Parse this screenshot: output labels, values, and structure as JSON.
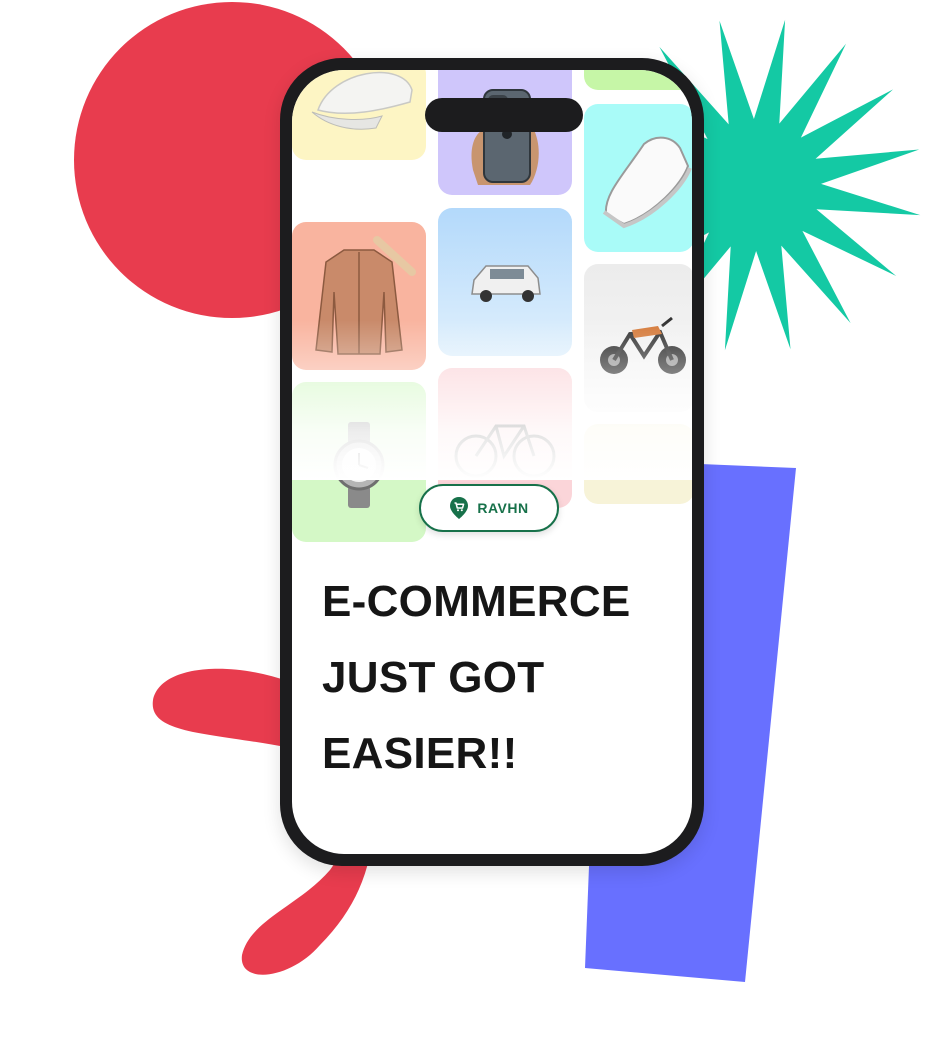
{
  "brand": {
    "name": "RAVHN",
    "icon": "shopping-cart-location-pin-icon",
    "color": "#17714a"
  },
  "headline": {
    "lines": [
      "E-COMMERCE",
      "JUST GOT",
      "EASIER!!"
    ]
  },
  "product_tiles": [
    {
      "icon": "cap-icon",
      "color": "#fdf5c4"
    },
    {
      "icon": "smartphone-icon",
      "color": "#cfc6fb"
    },
    {
      "icon": "sneaker-icon",
      "color": "#a9fbf8"
    },
    {
      "icon": "jacket-icon",
      "color": "#f9b49f"
    },
    {
      "icon": "suv-icon",
      "color": "#bfe0fb"
    },
    {
      "icon": "motorcycle-icon",
      "color": "#ececec"
    },
    {
      "icon": "watch-icon",
      "color": "#d4f8c6"
    },
    {
      "icon": "bicycle-icon",
      "color": "#fbd5d9"
    }
  ],
  "colors": {
    "red_blob": "#e83c4e",
    "green_starburst": "#14c9a4",
    "blue_bar": "#6870ff",
    "phone_frame": "#1c1c1e"
  }
}
